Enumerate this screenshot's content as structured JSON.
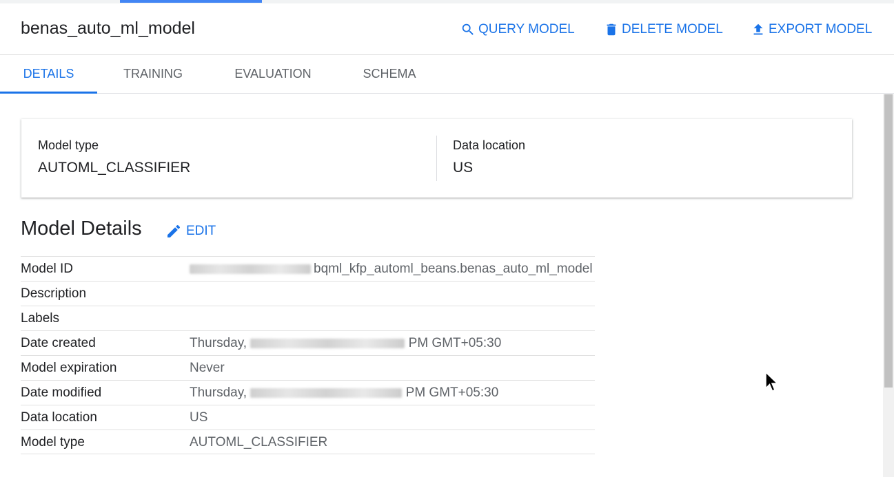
{
  "header": {
    "title": "benas_auto_ml_model",
    "actions": {
      "query": "QUERY MODEL",
      "delete": "DELETE MODEL",
      "export": "EXPORT MODEL"
    }
  },
  "tabs": [
    {
      "label": "DETAILS",
      "active": true
    },
    {
      "label": "TRAINING",
      "active": false
    },
    {
      "label": "EVALUATION",
      "active": false
    },
    {
      "label": "SCHEMA",
      "active": false
    }
  ],
  "summary": {
    "model_type_label": "Model type",
    "model_type_value": "AUTOML_CLASSIFIER",
    "data_location_label": "Data location",
    "data_location_value": "US"
  },
  "model_details": {
    "title": "Model Details",
    "edit_label": "EDIT",
    "rows": [
      {
        "key": "Model ID",
        "value": "bqml_kfp_automl_beans.benas_auto_ml_model"
      },
      {
        "key": "Description",
        "value": ""
      },
      {
        "key": "Labels",
        "value": ""
      },
      {
        "key": "Date created",
        "value_prefix": "Thursday,",
        "value_suffix": "PM GMT+05:30"
      },
      {
        "key": "Model expiration",
        "value": "Never"
      },
      {
        "key": "Date modified",
        "value_prefix": "Thursday,",
        "value_suffix": "PM GMT+05:30"
      },
      {
        "key": "Data location",
        "value": "US"
      },
      {
        "key": "Model type",
        "value": "AUTOML_CLASSIFIER"
      }
    ]
  },
  "colors": {
    "accent": "#1a73e8",
    "text": "#202124",
    "muted": "#5f6368"
  },
  "icons": {
    "query": "search-icon",
    "delete": "trash-icon",
    "export": "upload-icon",
    "edit": "pencil-icon"
  }
}
